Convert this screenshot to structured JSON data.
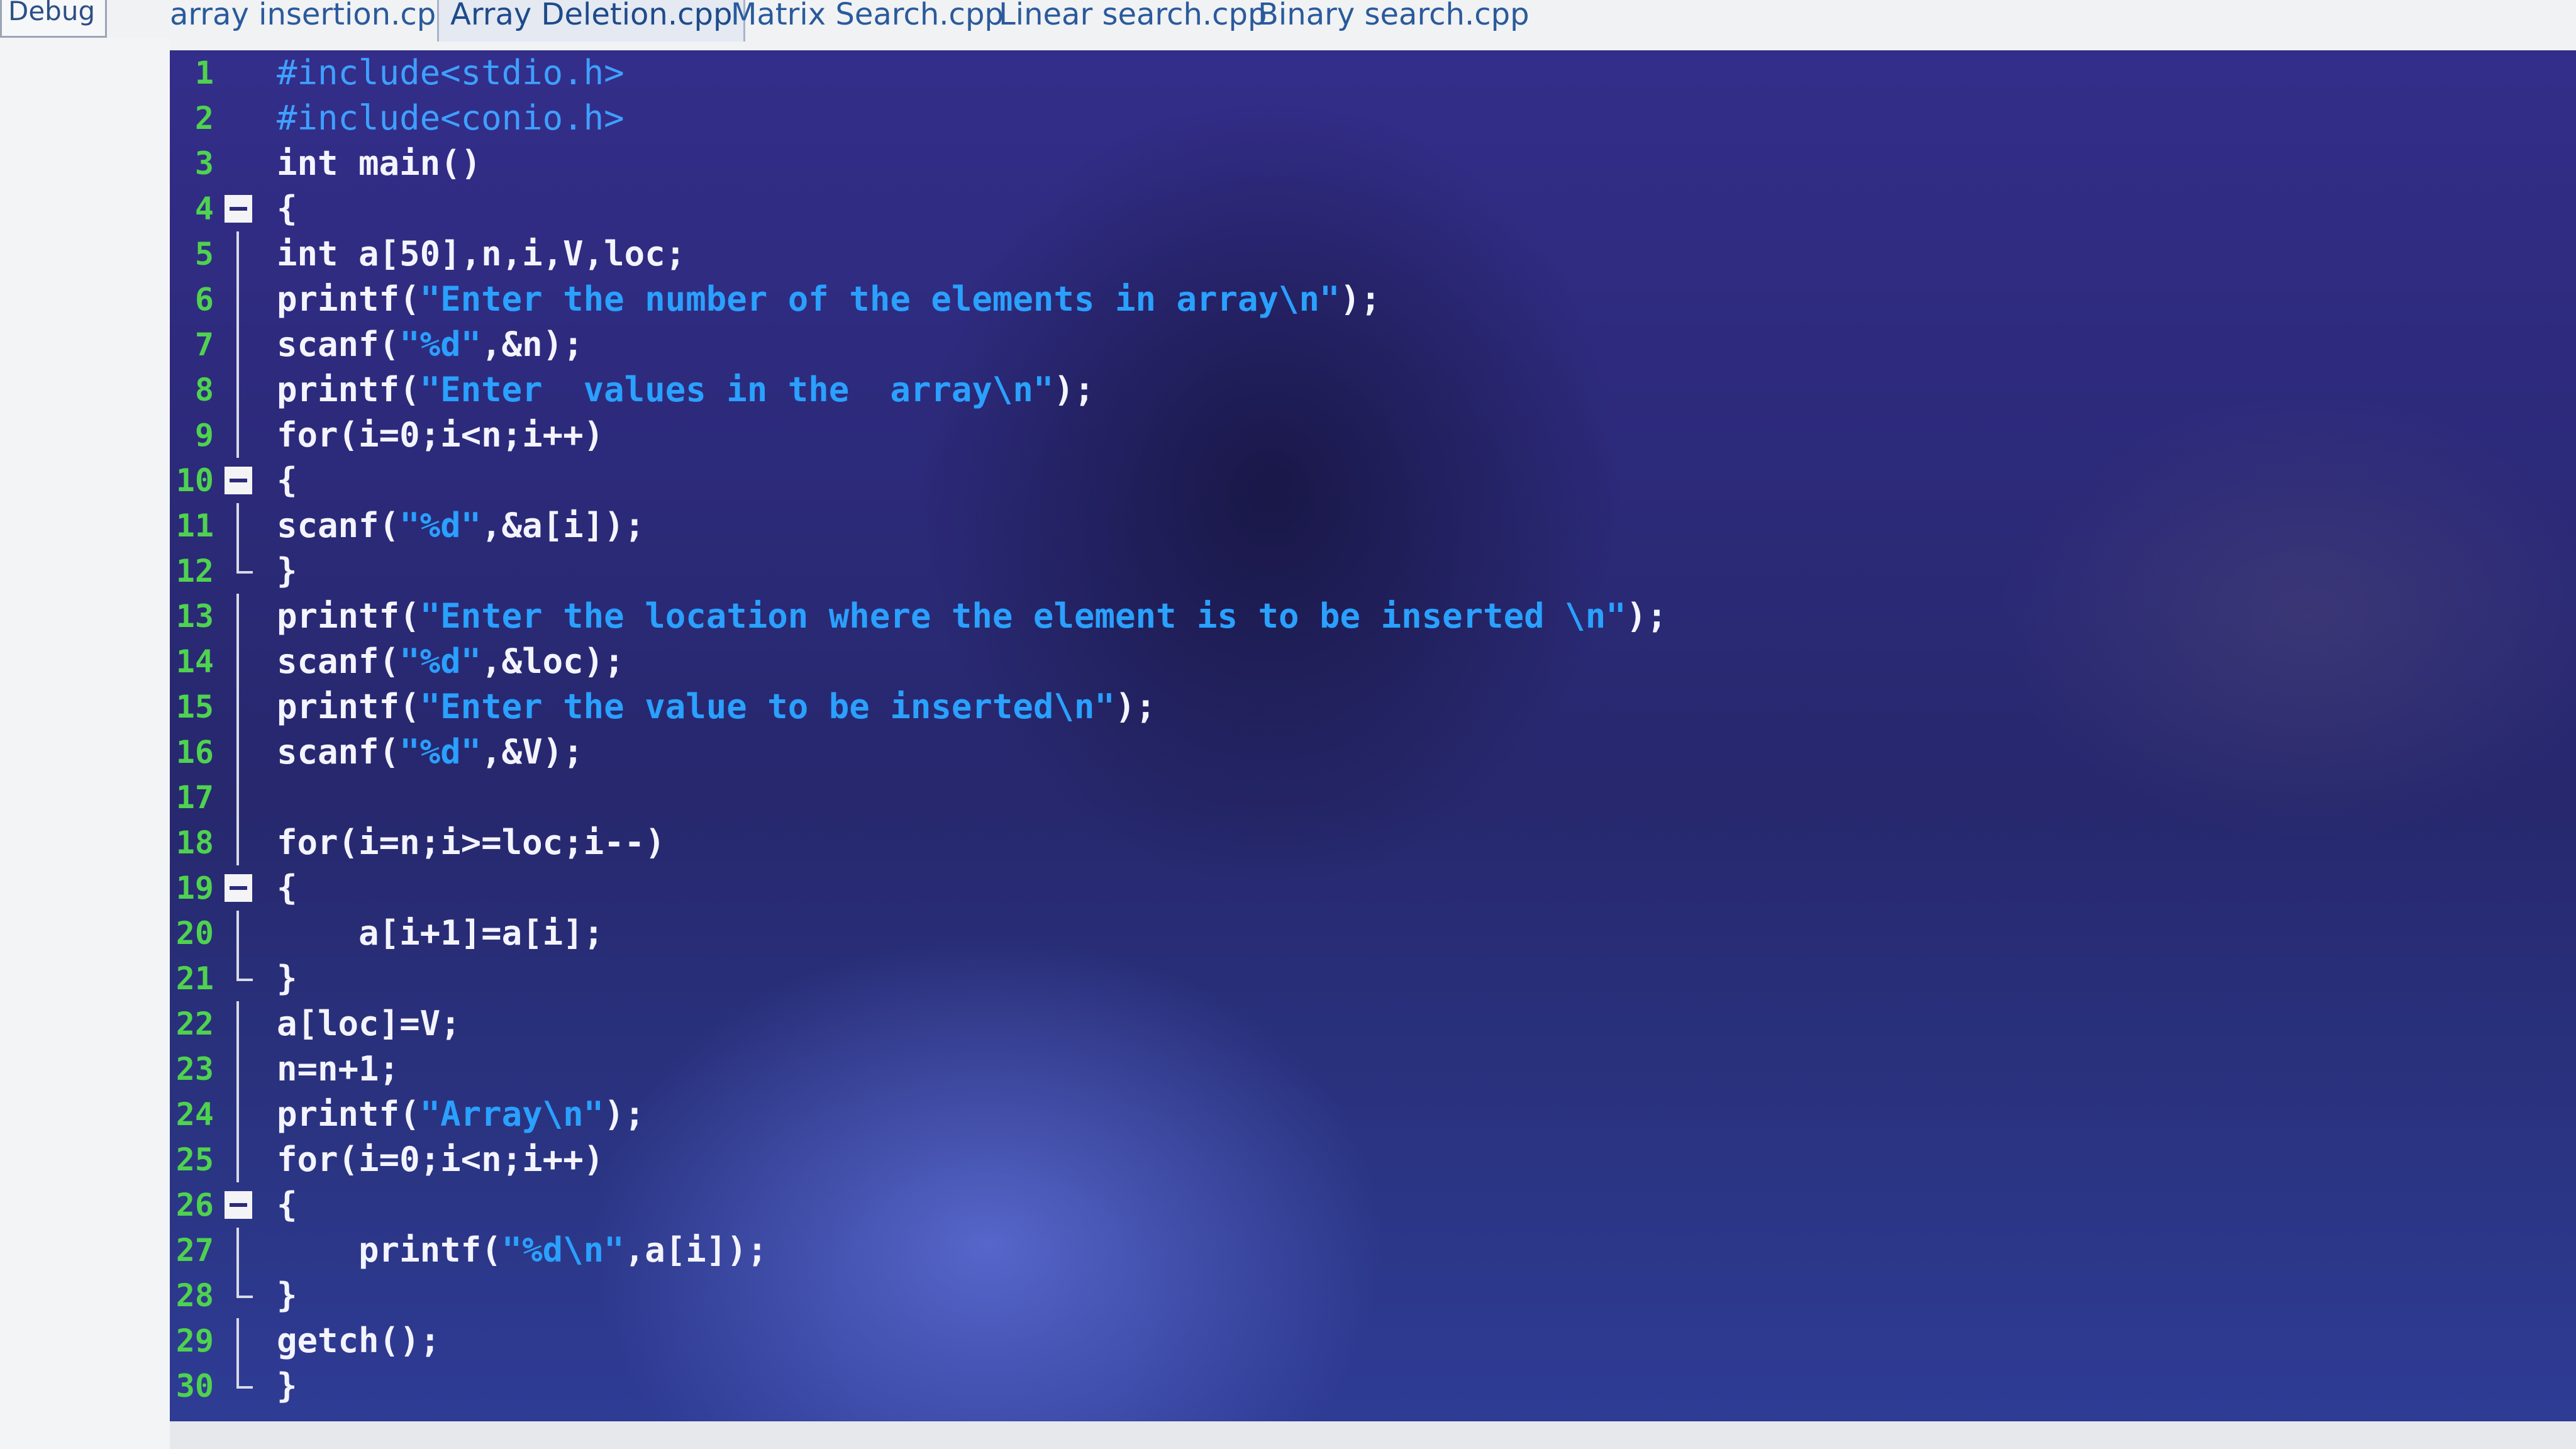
{
  "toolbar": {
    "build_config": "Debug"
  },
  "tabs": [
    {
      "label": "array insertion.cpp"
    },
    {
      "label": "Array Deletion.cpp"
    },
    {
      "label": "Matrix Search.cpp"
    },
    {
      "label": "Linear search.cpp"
    },
    {
      "label": "Binary search.cpp"
    }
  ],
  "active_tab": "Array Deletion.cpp",
  "editor": {
    "lines": [
      {
        "number": "1",
        "text": "#include<stdio.h>"
      },
      {
        "number": "2",
        "text": "#include<conio.h>"
      },
      {
        "number": "3",
        "text": "int main()"
      },
      {
        "number": "4",
        "text": "{"
      },
      {
        "number": "5",
        "text": "int a[50],n,i,V,loc;"
      },
      {
        "number": "6",
        "text": "printf(\"Enter the number of the elements in array\\n\");"
      },
      {
        "number": "7",
        "text": "scanf(\"%d\",&n);"
      },
      {
        "number": "8",
        "text": "printf(\"Enter  values in the  array\\n\");"
      },
      {
        "number": "9",
        "text": "for(i=0;i<n;i++)"
      },
      {
        "number": "10",
        "text": "{"
      },
      {
        "number": "11",
        "text": "scanf(\"%d\",&a[i]);"
      },
      {
        "number": "12",
        "text": "}"
      },
      {
        "number": "13",
        "text": "printf(\"Enter the location where the element is to be inserted \\n\");"
      },
      {
        "number": "14",
        "text": "scanf(\"%d\",&loc);"
      },
      {
        "number": "15",
        "text": "printf(\"Enter the value to be inserted\\n\");"
      },
      {
        "number": "16",
        "text": "scanf(\"%d\",&V);"
      },
      {
        "number": "17",
        "text": ""
      },
      {
        "number": "18",
        "text": "for(i=n;i>=loc;i--)"
      },
      {
        "number": "19",
        "text": "{"
      },
      {
        "number": "20",
        "text": "    a[i+1]=a[i];"
      },
      {
        "number": "21",
        "text": "}"
      },
      {
        "number": "22",
        "text": "a[loc]=V;"
      },
      {
        "number": "23",
        "text": "n=n+1;"
      },
      {
        "number": "24",
        "text": "printf(\"Array\\n\");"
      },
      {
        "number": "25",
        "text": "for(i=0;i<n;i++)"
      },
      {
        "number": "26",
        "text": "{"
      },
      {
        "number": "27",
        "text": "    printf(\"%d\\n\",a[i]);"
      },
      {
        "number": "28",
        "text": "}"
      },
      {
        "number": "29",
        "text": "getch();"
      },
      {
        "number": "30",
        "text": "}"
      }
    ]
  },
  "colors": {
    "editor_background": "#2c2a7a",
    "line_number": "#4fd24f",
    "code_text": "#f4f4ff",
    "string_literal": "#2aa0ff",
    "preprocessor": "#3ea0ff",
    "tab_text": "#2a5a9c"
  },
  "icons": {
    "fold_open": "fold-minus-icon",
    "fold_end": "fold-end-marker-icon"
  }
}
